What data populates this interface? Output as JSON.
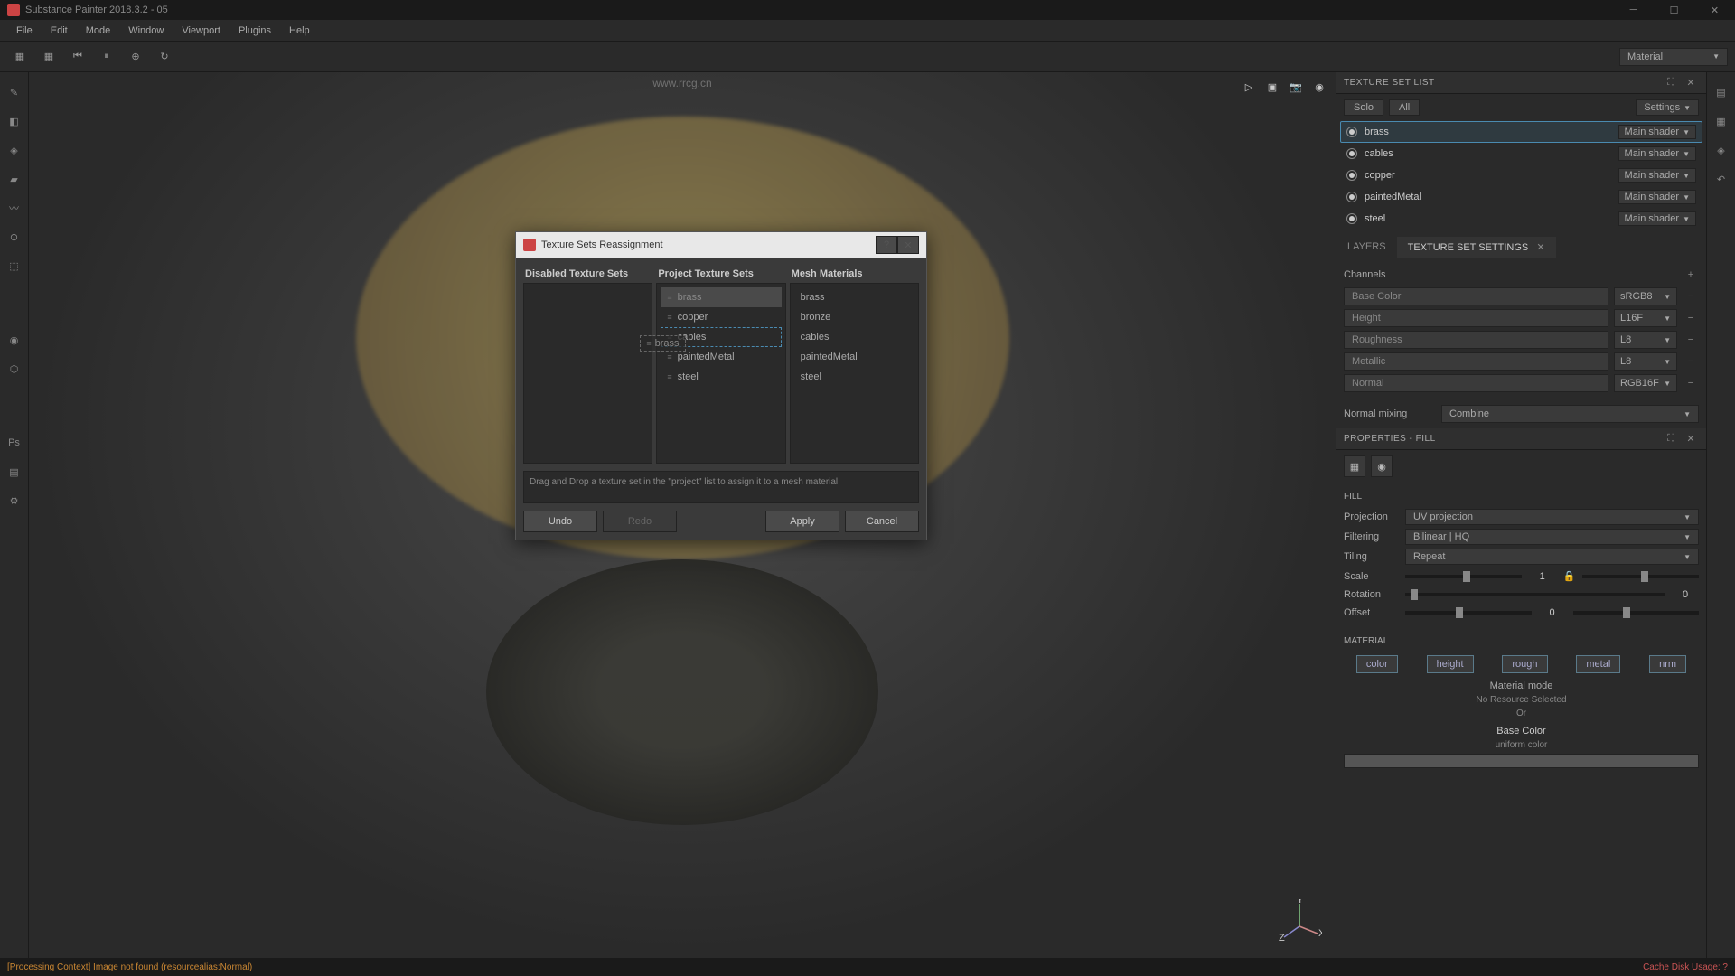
{
  "app": {
    "title": "Substance Painter 2018.3.2 - 05",
    "watermark": "www.rrcg.cn"
  },
  "menu": [
    "File",
    "Edit",
    "Mode",
    "Window",
    "Viewport",
    "Plugins",
    "Help"
  ],
  "materialDropdown": "Material",
  "viewportIcons": [
    "perspective",
    "camera1",
    "camera2",
    "render"
  ],
  "textureSetList": {
    "title": "TEXTURE SET LIST",
    "solo": "Solo",
    "all": "All",
    "settings": "Settings",
    "shaderLabel": "Main shader",
    "items": [
      {
        "name": "brass",
        "selected": true
      },
      {
        "name": "cables",
        "selected": false
      },
      {
        "name": "copper",
        "selected": false
      },
      {
        "name": "paintedMetal",
        "selected": false
      },
      {
        "name": "steel",
        "selected": false
      }
    ]
  },
  "tabs": {
    "layers": "LAYERS",
    "tsSettings": "TEXTURE SET SETTINGS"
  },
  "channels": {
    "label": "Channels",
    "items": [
      {
        "name": "Base Color",
        "format": "sRGB8"
      },
      {
        "name": "Height",
        "format": "L16F"
      },
      {
        "name": "Roughness",
        "format": "L8"
      },
      {
        "name": "Metallic",
        "format": "L8"
      },
      {
        "name": "Normal",
        "format": "RGB16F"
      }
    ]
  },
  "normalMixing": {
    "label": "Normal mixing",
    "value": "Combine"
  },
  "properties": {
    "title": "PROPERTIES - FILL"
  },
  "fill": {
    "header": "FILL",
    "projection": {
      "label": "Projection",
      "value": "UV projection"
    },
    "filtering": {
      "label": "Filtering",
      "value": "Bilinear | HQ"
    },
    "tiling": {
      "label": "Tiling",
      "value": "Repeat"
    },
    "scale": {
      "label": "Scale",
      "value": "1"
    },
    "rotation": {
      "label": "Rotation",
      "value": "0"
    },
    "offset": {
      "label": "Offset",
      "value": "0"
    }
  },
  "material": {
    "header": "MATERIAL",
    "buttons": [
      "color",
      "height",
      "rough",
      "metal",
      "nrm"
    ],
    "mode": "Material mode",
    "noResource": "No Resource Selected",
    "or": "Or",
    "baseColor": "Base Color",
    "uniform": "uniform color"
  },
  "dialog": {
    "title": "Texture Sets Reassignment",
    "cols": {
      "disabled": "Disabled Texture Sets",
      "project": "Project Texture Sets",
      "mesh": "Mesh Materials"
    },
    "disabledItems": [],
    "projectItems": [
      "brass",
      "copper",
      "cables",
      "paintedMetal",
      "steel"
    ],
    "meshItems": [
      "brass",
      "bronze",
      "cables",
      "paintedMetal",
      "steel"
    ],
    "ghostLabel": "brass",
    "hint": "Drag and Drop a texture set in the \"project\" list to assign it to a mesh material.",
    "buttons": {
      "undo": "Undo",
      "redo": "Redo",
      "apply": "Apply",
      "cancel": "Cancel"
    }
  },
  "status": {
    "msg": "[Processing Context] Image not found (resourcealias:Normal)",
    "cache": "Cache Disk Usage: ?"
  },
  "axis": {
    "x": "X",
    "y": "Y",
    "z": "Z"
  }
}
